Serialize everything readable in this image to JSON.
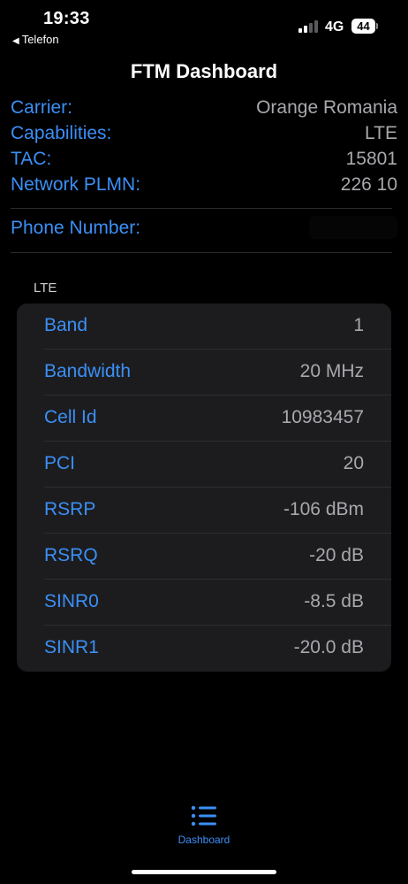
{
  "status_bar": {
    "time": "19:33",
    "back_app": "Telefon",
    "network": "4G",
    "battery": "44",
    "signal_bars_active": 2,
    "signal_bars_total": 4
  },
  "nav": {
    "title": "FTM Dashboard"
  },
  "info": {
    "carrier_label": "Carrier:",
    "carrier_value": "Orange Romania",
    "capabilities_label": "Capabilities:",
    "capabilities_value": "LTE",
    "tac_label": "TAC:",
    "tac_value": "15801",
    "plmn_label": "Network PLMN:",
    "plmn_value": "226 10",
    "phone_label": "Phone Number:"
  },
  "lte_section": {
    "header": "LTE",
    "rows": [
      {
        "label": "Band",
        "value": "1"
      },
      {
        "label": "Bandwidth",
        "value": "20 MHz"
      },
      {
        "label": "Cell Id",
        "value": "10983457"
      },
      {
        "label": "PCI",
        "value": "20"
      },
      {
        "label": "RSRP",
        "value": "-106 dBm"
      },
      {
        "label": "RSRQ",
        "value": "-20 dB"
      },
      {
        "label": "SINR0",
        "value": "-8.5 dB"
      },
      {
        "label": "SINR1",
        "value": "-20.0 dB"
      }
    ]
  },
  "tab_bar": {
    "dashboard_label": "Dashboard",
    "dashboard_icon": "list-bullet-icon"
  },
  "colors": {
    "accent": "#3b8ff6",
    "value_gray": "#a8a8ad",
    "card_bg": "#1c1c1e",
    "background": "#000000"
  }
}
